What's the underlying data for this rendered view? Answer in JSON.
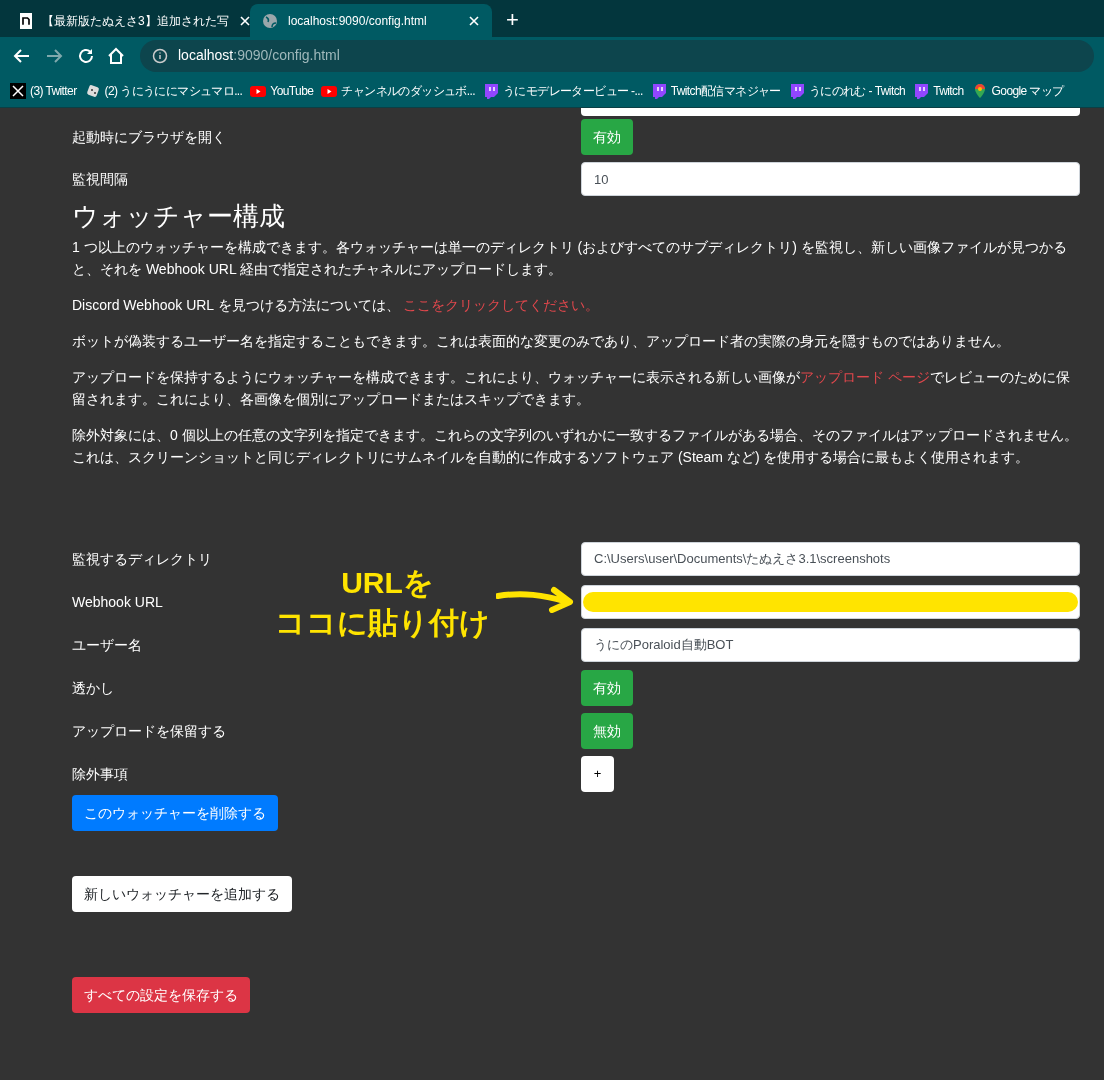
{
  "browser": {
    "tabs": [
      {
        "kind": "note",
        "title": "【最新版たぬえさ3】追加された写",
        "selected": false
      },
      {
        "kind": "globe",
        "title": "localhost:9090/config.html",
        "selected": true
      }
    ],
    "new_tab": "+",
    "address": {
      "host": "localhost",
      "path": ":9090/config.html"
    },
    "bookmarks": [
      {
        "kind": "x",
        "label": "(3) Twitter"
      },
      {
        "kind": "dice",
        "label": "(2) うにうににマシュマロ..."
      },
      {
        "kind": "youtube",
        "label": "YouTube"
      },
      {
        "kind": "youtube",
        "label": "チャンネルのダッシュボ..."
      },
      {
        "kind": "twitch",
        "label": "うにモデレータービュー -..."
      },
      {
        "kind": "twitch",
        "label": "Twitch配信マネジャー"
      },
      {
        "kind": "twitch",
        "label": "うにのれむ - Twitch"
      },
      {
        "kind": "twitch",
        "label": "Twitch"
      },
      {
        "kind": "maps",
        "label": "Google マップ"
      }
    ]
  },
  "settings": [
    {
      "kind": "toggle",
      "label": "起動時にブラウザを開く",
      "value": "有効"
    },
    {
      "kind": "input",
      "label": "監視間隔",
      "value": "10"
    }
  ],
  "heading": "ウォッチャー構成",
  "paragraphs": [
    [
      {
        "text": "1 つ以上のウォッチャーを構成できます。各ウォッチャーは単一のディレクトリ (およびすべてのサブディレクトリ) を監視し、新しい画像ファイルが見つかると、それを Webhook URL 経由で指定されたチャネルにアップロードします。",
        "link": false
      }
    ],
    [
      {
        "text": "Discord Webhook URL を見つける方法については、 ",
        "link": false
      },
      {
        "text": "ここをクリックしてください。",
        "link": true
      }
    ],
    [
      {
        "text": "ボットが偽装するユーザー名を指定することもできます。これは表面的な変更のみであり、アップロード者の実際の身元を隠すものではありません。",
        "link": false
      }
    ],
    [
      {
        "text": "アップロードを保持するようにウォッチャーを構成できます。これにより、ウォッチャーに表示される新しい画像が",
        "link": false
      },
      {
        "text": "アップロード ページ",
        "link": true
      },
      {
        "text": "でレビューのために保留されます。これにより、各画像を個別にアップロードまたはスキップできます。",
        "link": false
      }
    ],
    [
      {
        "text": "除外対象には、0 個以上の任意の文字列を指定できます。これらの文字列のいずれかに一致するファイルがある場合、そのファイルはアップロードされません。これは、スクリーンショットと同じディレクトリにサムネイルを自動的に作成するソフトウェア (Steam など) を使用する場合に最もよく使用されます。",
        "link": false
      }
    ]
  ],
  "watcher_fields": [
    {
      "kind": "input",
      "label": "監視するディレクトリ",
      "value": "C:\\Users\\user\\Documents\\たぬえさ3.1\\screenshots"
    },
    {
      "kind": "redacted",
      "label": "Webhook URL"
    },
    {
      "kind": "input",
      "label": "ユーザー名",
      "value": "うにのPoraloid自動BOT"
    },
    {
      "kind": "toggle",
      "label": "透かし",
      "value": "有効"
    },
    {
      "kind": "toggle",
      "label": "アップロードを保留する",
      "value": "無効"
    },
    {
      "kind": "add",
      "label": "除外事項",
      "value": "+"
    }
  ],
  "delete_button": "このウォッチャーを削除する",
  "add_button": "新しいウォッチャーを追加する",
  "save_button": "すべての設定を保存する",
  "annotation": [
    "URLを",
    "ココに貼り付け"
  ]
}
